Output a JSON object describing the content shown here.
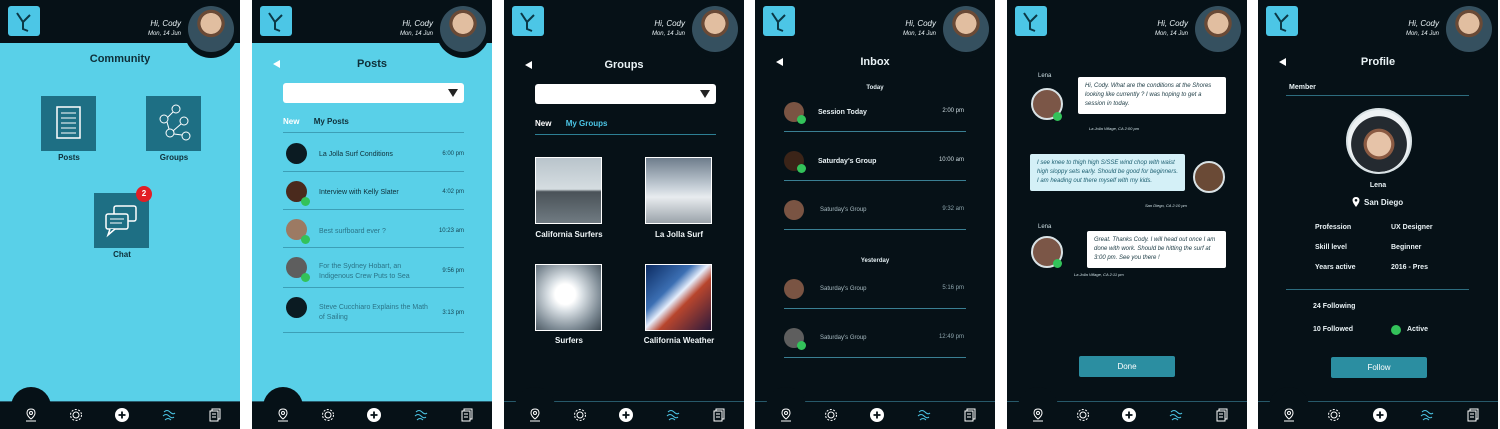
{
  "header": {
    "greeting": "Hi, Cody",
    "date": "Mon, 14 Jun"
  },
  "nav": {
    "icons": [
      "map-pin-icon",
      "gear-icon",
      "plus-icon",
      "waves-icon",
      "documents-icon"
    ]
  },
  "community": {
    "title": "Community",
    "tiles": [
      {
        "label": "Posts",
        "icon": "document-icon"
      },
      {
        "label": "Groups",
        "icon": "people-network-icon"
      },
      {
        "label": "Chat",
        "icon": "chat-bubbles-icon",
        "badge": "2"
      }
    ]
  },
  "posts": {
    "title": "Posts",
    "tabs": [
      "New",
      "My Posts"
    ],
    "items": [
      {
        "text": "La Jolla Surf Conditions",
        "time": "6:00 pm"
      },
      {
        "text": "Interview with Kelly Slater",
        "time": "4:02 pm"
      },
      {
        "text": "Best surfboard ever ?",
        "time": "10:23 am"
      },
      {
        "text": "For the Sydney Hobart, an Indigenous Crew Puts to Sea",
        "time": "9:56 pm"
      },
      {
        "text": "Steve Cucchiaro Explains the Math of Sailing",
        "time": "3:13 pm"
      }
    ]
  },
  "groups": {
    "title": "Groups",
    "tabs": [
      "New",
      "My Groups"
    ],
    "items": [
      {
        "label": "California Surfers"
      },
      {
        "label": "La Jolla Surf"
      },
      {
        "label": "Surfers"
      },
      {
        "label": "California Weather"
      }
    ]
  },
  "inbox": {
    "title": "Inbox",
    "today_label": "Today",
    "yesterday_label": "Yesterday",
    "today": [
      {
        "name": "Session Today",
        "time": "2:00 pm"
      },
      {
        "name": "Saturday's Group",
        "time": "10:00 am"
      },
      {
        "name": "Saturday's Group",
        "time": "9:32 am"
      }
    ],
    "yesterday": [
      {
        "name": "Saturday's Group",
        "time": "5:16 pm"
      },
      {
        "name": "Saturday's Group",
        "time": "12:49 pm"
      }
    ]
  },
  "chat": {
    "messages": [
      {
        "sender": "Lena",
        "text": "Hi, Cody. What are the conditions at the Shores looking like currently ? I was hoping to get a session in today.",
        "meta": "La Jolla Village, CA  2:00 pm"
      },
      {
        "sender": "Cody",
        "text": "I see knee to thigh high S/SSE wind chop with waist high sloppy sets early. Should be good for beginners. I am heading out there myself with my kids.",
        "meta": "San Diego, CA  2:10 pm"
      },
      {
        "sender": "Lena",
        "text": "Great. Thanks Cody. I will head out once I am done with work. Should be hitting the surf at 3:00 pm. See you there !",
        "meta": "La Jolla Village, CA  2:11 pm"
      }
    ],
    "done_label": "Done"
  },
  "profile": {
    "title": "Profile",
    "member_label": "Member",
    "name": "Lena",
    "location": "San Diego",
    "fields": [
      {
        "label": "Profession",
        "value": "UX Designer"
      },
      {
        "label": "Skill level",
        "value": "Beginner"
      },
      {
        "label": "Years active",
        "value": "2016 - Pres"
      }
    ],
    "following": "24 Following",
    "followed": "10 Followed",
    "status": "Active",
    "follow_label": "Follow"
  },
  "colors": {
    "accent": "#59d0e8",
    "dark": "#061117",
    "button": "#2b8ea1",
    "badge": "#e21e25",
    "active": "#33c25a"
  }
}
